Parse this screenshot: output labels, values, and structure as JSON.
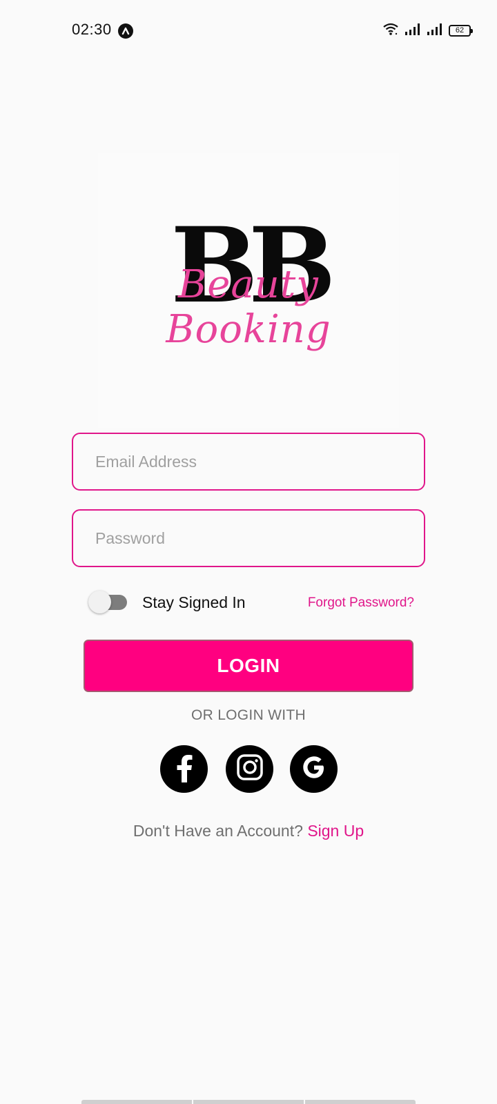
{
  "status_bar": {
    "time": "02:30",
    "battery": "62",
    "icons": [
      "app-notification-icon",
      "wifi-icon",
      "signal-icon",
      "signal-icon",
      "battery-icon"
    ]
  },
  "logo": {
    "monogram": "BB",
    "script": "Beauty Booking",
    "accent_color": "#e7449a"
  },
  "form": {
    "email_placeholder": "Email Address",
    "email_value": "",
    "password_placeholder": "Password",
    "password_value": "",
    "stay_signed_in_label": "Stay Signed In",
    "stay_signed_in": false,
    "forgot_password": "Forgot Password?",
    "login_label": "LOGIN"
  },
  "social": {
    "divider_text": "OR LOGIN WITH",
    "providers": [
      "facebook-icon",
      "instagram-icon",
      "google-icon"
    ]
  },
  "signup": {
    "prompt": "Don't Have an Account?",
    "link": "Sign Up"
  },
  "colors": {
    "brand": "#ff0080",
    "border": "#e0168a",
    "background": "#fafafa"
  }
}
